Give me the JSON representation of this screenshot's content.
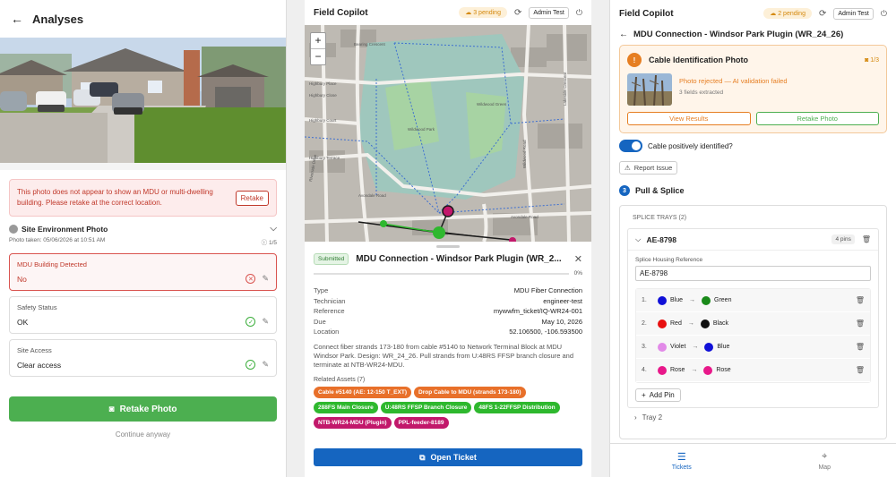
{
  "panel1": {
    "title": "Analyses",
    "alert_text": "This photo does not appear to show an MDU or multi-dwelling building. Please retake at the correct location.",
    "alert_button": "Retake",
    "section_title": "Site Environment Photo",
    "photo_taken": "Photo taken: 05/06/2026 at 10:51 AM",
    "photo_count": "1/5",
    "fields": [
      {
        "label": "MDU Building Detected",
        "value": "No"
      },
      {
        "label": "Safety Status",
        "value": "OK"
      },
      {
        "label": "Site Access",
        "value": "Clear access"
      }
    ],
    "retake_button": "Retake Photo",
    "continue_link": "Continue anyway"
  },
  "panel2": {
    "app_title": "Field Copilot",
    "pending": "3 pending",
    "user": "Admin Test",
    "map_labels": [
      "Bearing Crescent",
      "Highbury Place",
      "Highbury Close",
      "Highbury Court",
      "Wildwood Park",
      "Wildwood Green",
      "Highbury Terrace",
      "Avondale Road",
      "Avondale Road",
      "Riverside Drive",
      "Wildwood Road",
      "Lakeside Crescent"
    ],
    "status": "Submitted",
    "ticket_title": "MDU Connection - Windsor Park Plugin (WR_2...",
    "progress": "0%",
    "details": [
      {
        "k": "Type",
        "v": "MDU Fiber Connection"
      },
      {
        "k": "Technician",
        "v": "engineer-test"
      },
      {
        "k": "Reference",
        "v": "mywwfm_ticket/IQ-WR24-001"
      },
      {
        "k": "Due",
        "v": "May 10, 2026"
      },
      {
        "k": "Location",
        "v": "52.106500, -106.593500"
      }
    ],
    "description": "Connect fiber strands 173-180 from cable #5140 to Network Terminal Block at MDU Windsor Park. Design: WR_24_26. Pull strands from U:48RS FFSP branch closure and terminate at NTB-WR24-MDU.",
    "related_label": "Related Assets (7)",
    "chips": [
      {
        "label": "Cable #5140 (AE: 12-150 T_EXT)",
        "color": "#e8702a"
      },
      {
        "label": "Drop Cable to MDU (strands 173-180)",
        "color": "#e8702a"
      },
      {
        "label": "288FS Main Closure",
        "color": "#2eb82e"
      },
      {
        "label": "U:48RS FFSP Branch Closure",
        "color": "#2eb82e"
      },
      {
        "label": "48FS 1-22FFSP Distribution",
        "color": "#2eb82e"
      },
      {
        "label": "NTB-WR24-MDU (Plugin)",
        "color": "#c2186b"
      },
      {
        "label": "PPL-feeder-8189",
        "color": "#c2186b"
      }
    ],
    "open_button": "Open Ticket"
  },
  "panel3": {
    "app_title": "Field Copilot",
    "pending": "2 pending",
    "user": "Admin Test",
    "page_title": "MDU Connection - Windsor Park Plugin (WR_24_26)",
    "card_title": "Cable Identification Photo",
    "card_count": "1/3",
    "rejected": "Photo rejected — AI validation failed",
    "fields_extracted": "3 fields extracted",
    "view_results": "View Results",
    "retake_photo": "Retake Photo",
    "toggle_label": "Cable positively identified?",
    "report_issue": "Report Issue",
    "step_number": "3",
    "step_title": "Pull & Splice",
    "splice_trays_label": "SPLICE TRAYS (2)",
    "tray_name": "AE-8798",
    "tray_pins": "4 pins",
    "housing_label": "Splice Housing Reference",
    "housing_value": "AE-8798",
    "pins": [
      {
        "n": "1.",
        "from": "Blue",
        "from_color": "#1010d8",
        "to": "Green",
        "to_color": "#1a8a1a"
      },
      {
        "n": "2.",
        "from": "Red",
        "from_color": "#e81010",
        "to": "Black",
        "to_color": "#111111"
      },
      {
        "n": "3.",
        "from": "Violet",
        "from_color": "#e28ae8",
        "to": "Blue",
        "to_color": "#1010d8"
      },
      {
        "n": "4.",
        "from": "Rose",
        "from_color": "#e8188a",
        "to": "Rose",
        "to_color": "#e8188a"
      }
    ],
    "add_pin": "Add Pin",
    "tray2": "Tray 2",
    "nav": [
      {
        "label": "Tickets",
        "icon": "list-icon"
      },
      {
        "label": "Map",
        "icon": "pin-icon"
      }
    ]
  }
}
